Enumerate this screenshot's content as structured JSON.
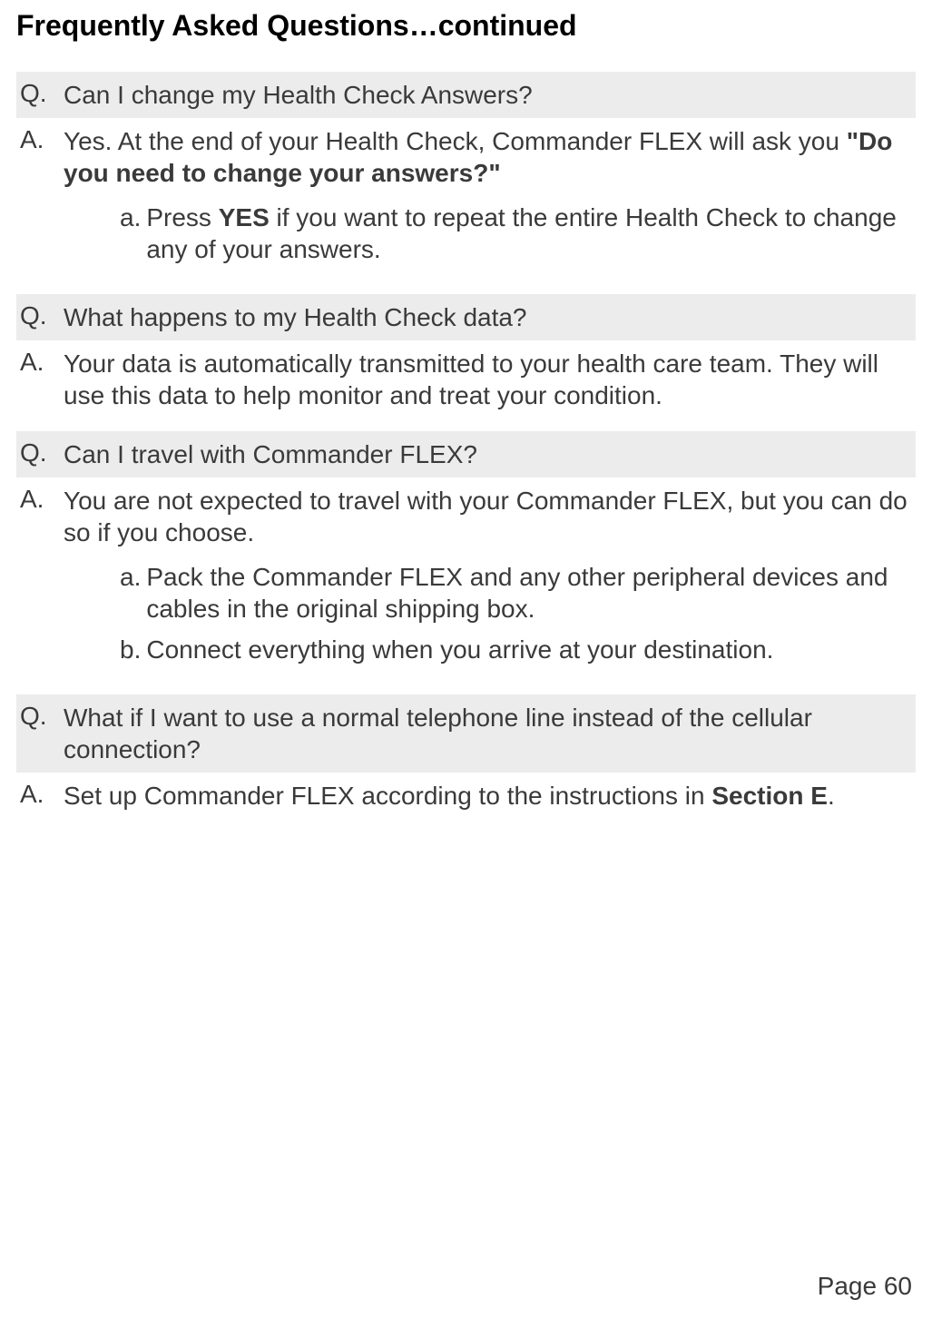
{
  "title": "Frequently Asked Questions…continued",
  "labels": {
    "q": "Q.",
    "a": "A."
  },
  "faq": [
    {
      "question": "Can I change my Health Check Answers?",
      "answer_pre": "Yes.  At the end of your Health Check, Commander FLEX will ask you ",
      "answer_bold": "\"Do you need to change your answers?\"",
      "answer_post": "",
      "subs": [
        {
          "label": "a.",
          "pre": "Press ",
          "bold": "YES",
          "post": " if you want to repeat the entire Health Check to change any of your answers."
        }
      ]
    },
    {
      "question": "What happens to my Health Check data?",
      "answer_pre": "Your data is automatically transmitted to your health care team. They will use this data to help monitor and treat your condition.",
      "answer_bold": "",
      "answer_post": "",
      "subs": []
    },
    {
      "question": "Can I travel with Commander FLEX?",
      "answer_pre": "You are not expected to travel with your Commander FLEX, but you can do so if you choose.",
      "answer_bold": "",
      "answer_post": "",
      "subs": [
        {
          "label": "a.",
          "pre": "Pack the Commander FLEX and any other peripheral devices and cables in the original shipping box.",
          "bold": "",
          "post": ""
        },
        {
          "label": "b.",
          "pre": "Connect everything when you arrive at your destination.",
          "bold": "",
          "post": ""
        }
      ]
    },
    {
      "question": "What if I want to use a normal telephone line instead of the cellular connection?",
      "answer_pre": "Set up Commander FLEX according to the instructions in ",
      "answer_bold": "Section E",
      "answer_post": ".",
      "subs": []
    }
  ],
  "page_number": "Page 60"
}
